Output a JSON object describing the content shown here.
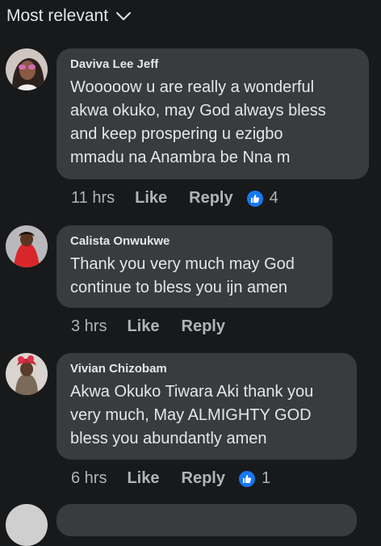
{
  "sort": {
    "label": "Most relevant"
  },
  "comments": [
    {
      "author": "Daviva Lee Jeff",
      "text": "Wooooow u are really a wonderful\nakwa okuko, may God always bless\nand keep prospering u ezigbo\nmmadu na Anambra be Nna m",
      "time": "11 hrs",
      "like_label": "Like",
      "reply_label": "Reply",
      "reaction_count": "4"
    },
    {
      "author": "Calista Onwukwe",
      "text": "Thank you very much may God\ncontinue to bless you ijn amen",
      "time": "3 hrs",
      "like_label": "Like",
      "reply_label": "Reply"
    },
    {
      "author": "Vivian Chizobam",
      "text": "Akwa Okuko Tiwara Aki thank you\nvery much, May ALMIGHTY GOD\nbless you abundantly amen",
      "time": "6 hrs",
      "like_label": "Like",
      "reply_label": "Reply",
      "reaction_count": "1"
    }
  ],
  "colors": {
    "background": "#18191a",
    "bubble": "#3a3b3c",
    "text": "#e4e6eb",
    "secondary_text": "#b0b3b8",
    "like_badge": "#1877f2"
  },
  "icons": {
    "sort": "chevron-down-icon",
    "reaction": "thumbs-up-icon"
  }
}
